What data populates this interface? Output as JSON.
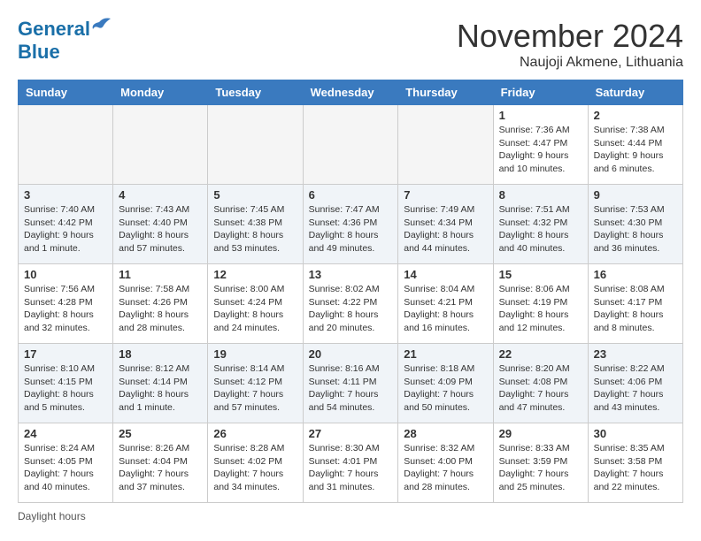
{
  "header": {
    "logo_line1": "General",
    "logo_line2": "Blue",
    "month_title": "November 2024",
    "subtitle": "Naujoji Akmene, Lithuania"
  },
  "days_of_week": [
    "Sunday",
    "Monday",
    "Tuesday",
    "Wednesday",
    "Thursday",
    "Friday",
    "Saturday"
  ],
  "footer": {
    "label": "Daylight hours"
  },
  "weeks": [
    [
      {
        "day": "",
        "info": ""
      },
      {
        "day": "",
        "info": ""
      },
      {
        "day": "",
        "info": ""
      },
      {
        "day": "",
        "info": ""
      },
      {
        "day": "",
        "info": ""
      },
      {
        "day": "1",
        "info": "Sunrise: 7:36 AM\nSunset: 4:47 PM\nDaylight: 9 hours and 10 minutes."
      },
      {
        "day": "2",
        "info": "Sunrise: 7:38 AM\nSunset: 4:44 PM\nDaylight: 9 hours and 6 minutes."
      }
    ],
    [
      {
        "day": "3",
        "info": "Sunrise: 7:40 AM\nSunset: 4:42 PM\nDaylight: 9 hours and 1 minute."
      },
      {
        "day": "4",
        "info": "Sunrise: 7:43 AM\nSunset: 4:40 PM\nDaylight: 8 hours and 57 minutes."
      },
      {
        "day": "5",
        "info": "Sunrise: 7:45 AM\nSunset: 4:38 PM\nDaylight: 8 hours and 53 minutes."
      },
      {
        "day": "6",
        "info": "Sunrise: 7:47 AM\nSunset: 4:36 PM\nDaylight: 8 hours and 49 minutes."
      },
      {
        "day": "7",
        "info": "Sunrise: 7:49 AM\nSunset: 4:34 PM\nDaylight: 8 hours and 44 minutes."
      },
      {
        "day": "8",
        "info": "Sunrise: 7:51 AM\nSunset: 4:32 PM\nDaylight: 8 hours and 40 minutes."
      },
      {
        "day": "9",
        "info": "Sunrise: 7:53 AM\nSunset: 4:30 PM\nDaylight: 8 hours and 36 minutes."
      }
    ],
    [
      {
        "day": "10",
        "info": "Sunrise: 7:56 AM\nSunset: 4:28 PM\nDaylight: 8 hours and 32 minutes."
      },
      {
        "day": "11",
        "info": "Sunrise: 7:58 AM\nSunset: 4:26 PM\nDaylight: 8 hours and 28 minutes."
      },
      {
        "day": "12",
        "info": "Sunrise: 8:00 AM\nSunset: 4:24 PM\nDaylight: 8 hours and 24 minutes."
      },
      {
        "day": "13",
        "info": "Sunrise: 8:02 AM\nSunset: 4:22 PM\nDaylight: 8 hours and 20 minutes."
      },
      {
        "day": "14",
        "info": "Sunrise: 8:04 AM\nSunset: 4:21 PM\nDaylight: 8 hours and 16 minutes."
      },
      {
        "day": "15",
        "info": "Sunrise: 8:06 AM\nSunset: 4:19 PM\nDaylight: 8 hours and 12 minutes."
      },
      {
        "day": "16",
        "info": "Sunrise: 8:08 AM\nSunset: 4:17 PM\nDaylight: 8 hours and 8 minutes."
      }
    ],
    [
      {
        "day": "17",
        "info": "Sunrise: 8:10 AM\nSunset: 4:15 PM\nDaylight: 8 hours and 5 minutes."
      },
      {
        "day": "18",
        "info": "Sunrise: 8:12 AM\nSunset: 4:14 PM\nDaylight: 8 hours and 1 minute."
      },
      {
        "day": "19",
        "info": "Sunrise: 8:14 AM\nSunset: 4:12 PM\nDaylight: 7 hours and 57 minutes."
      },
      {
        "day": "20",
        "info": "Sunrise: 8:16 AM\nSunset: 4:11 PM\nDaylight: 7 hours and 54 minutes."
      },
      {
        "day": "21",
        "info": "Sunrise: 8:18 AM\nSunset: 4:09 PM\nDaylight: 7 hours and 50 minutes."
      },
      {
        "day": "22",
        "info": "Sunrise: 8:20 AM\nSunset: 4:08 PM\nDaylight: 7 hours and 47 minutes."
      },
      {
        "day": "23",
        "info": "Sunrise: 8:22 AM\nSunset: 4:06 PM\nDaylight: 7 hours and 43 minutes."
      }
    ],
    [
      {
        "day": "24",
        "info": "Sunrise: 8:24 AM\nSunset: 4:05 PM\nDaylight: 7 hours and 40 minutes."
      },
      {
        "day": "25",
        "info": "Sunrise: 8:26 AM\nSunset: 4:04 PM\nDaylight: 7 hours and 37 minutes."
      },
      {
        "day": "26",
        "info": "Sunrise: 8:28 AM\nSunset: 4:02 PM\nDaylight: 7 hours and 34 minutes."
      },
      {
        "day": "27",
        "info": "Sunrise: 8:30 AM\nSunset: 4:01 PM\nDaylight: 7 hours and 31 minutes."
      },
      {
        "day": "28",
        "info": "Sunrise: 8:32 AM\nSunset: 4:00 PM\nDaylight: 7 hours and 28 minutes."
      },
      {
        "day": "29",
        "info": "Sunrise: 8:33 AM\nSunset: 3:59 PM\nDaylight: 7 hours and 25 minutes."
      },
      {
        "day": "30",
        "info": "Sunrise: 8:35 AM\nSunset: 3:58 PM\nDaylight: 7 hours and 22 minutes."
      }
    ]
  ]
}
